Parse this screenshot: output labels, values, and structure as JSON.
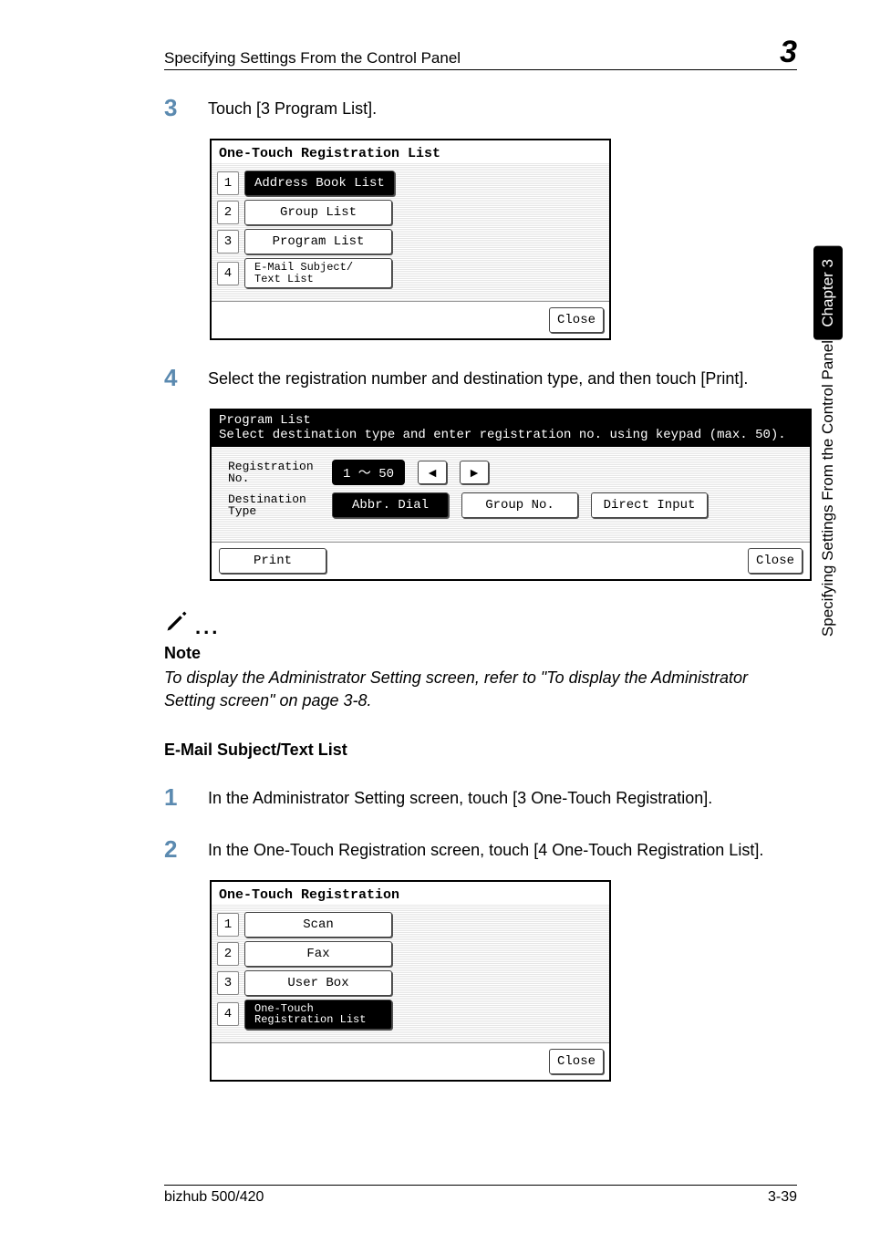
{
  "header": {
    "title": "Specifying Settings From the Control Panel",
    "chapter_badge": "3"
  },
  "side": {
    "black": "Chapter 3",
    "gray": "Specifying Settings From the Control Panel"
  },
  "step3": {
    "num": "3",
    "text": "Touch [3 Program List]."
  },
  "lcd1": {
    "title": "One-Touch Registration List",
    "items": [
      {
        "n": "1",
        "label": "Address Book List"
      },
      {
        "n": "2",
        "label": "Group List"
      },
      {
        "n": "3",
        "label": "Program List"
      },
      {
        "n": "4",
        "label": "E-Mail Subject/\nText List"
      }
    ],
    "close": "Close"
  },
  "step4": {
    "num": "4",
    "text": "Select the registration number and destination type, and then touch [Print]."
  },
  "lcd2": {
    "title": "Program List",
    "subtitle": "Select destination type and enter registration no. using keypad (max. 50).",
    "reg_label": "Registration\nNo.",
    "reg_value": "1 ～ 50",
    "dest_label": "Destination\nType",
    "dest_buttons": {
      "abbr": "Abbr. Dial",
      "group": "Group No.",
      "direct": "Direct Input"
    },
    "print": "Print",
    "close": "Close"
  },
  "note": {
    "heading": "Note",
    "body": "To display the Administrator Setting screen, refer to \"To display the Administrator Setting screen\" on page 3-8."
  },
  "section2": {
    "heading": "E-Mail Subject/Text List"
  },
  "step1b": {
    "num": "1",
    "text": "In the Administrator Setting screen, touch [3 One-Touch Registration]."
  },
  "step2b": {
    "num": "2",
    "text": "In the One-Touch Registration screen, touch [4 One-Touch Registration List]."
  },
  "lcd3": {
    "title": "One-Touch Registration",
    "items": [
      {
        "n": "1",
        "label": "Scan"
      },
      {
        "n": "2",
        "label": "Fax"
      },
      {
        "n": "3",
        "label": "User Box"
      },
      {
        "n": "4",
        "label": "One-Touch\nRegistration List"
      }
    ],
    "close": "Close"
  },
  "footer": {
    "left": "bizhub 500/420",
    "right": "3-39"
  }
}
